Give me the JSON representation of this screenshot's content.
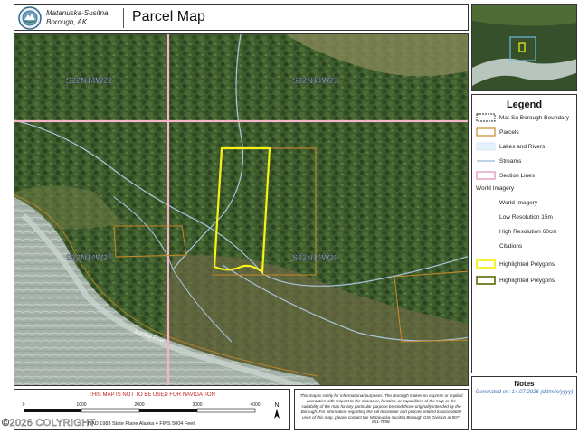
{
  "header": {
    "org_line1": "Matanuska-Susitna",
    "org_line2": "Borough, AK",
    "title": "Parcel Map"
  },
  "map": {
    "section_labels": [
      "S22N14W22",
      "S22N14W23",
      "S22N14W27",
      "S22N14W26"
    ],
    "river_label": "Susitna River"
  },
  "colors": {
    "section_lines": "#f4b6c6",
    "parcels": "#c98a2a",
    "highlight": "#f5f21a",
    "streams": "#a9c6dd",
    "forest": "#3d5a2c",
    "riverbed": "#a8b6ad"
  },
  "legend": {
    "title": "Legend",
    "items": [
      {
        "label": "Mat-Su Borough Boundary",
        "indent": false
      },
      {
        "label": "Parcels",
        "indent": false
      },
      {
        "label": "Lakes and Rivers",
        "indent": false
      },
      {
        "label": "Streams",
        "indent": false
      },
      {
        "label": "Section Lines",
        "indent": false
      },
      {
        "label": "World Imagery",
        "indent": false
      },
      {
        "label": "World Imagery",
        "indent": true
      },
      {
        "label": "Low Resolution 15m",
        "indent": true
      },
      {
        "label": "High Resolution 60cm",
        "indent": true
      },
      {
        "label": "Citations",
        "indent": true
      },
      {
        "label": "Highlighted Polygons",
        "indent": false
      },
      {
        "label": "Highlighted Polygons",
        "indent": false
      }
    ]
  },
  "notes": {
    "title": "Notes",
    "text": "Generated on: 14.07.2026 (dd/mm/yyyy)"
  },
  "scale": {
    "warning": "THIS MAP IS NOT TO BE USED FOR NAVIGATION",
    "ticks": [
      "0",
      "1000",
      "2000",
      "3000",
      "4000"
    ],
    "north_label": "N",
    "projection": "NAD 1983 State Plane Alaska 4 FIPS 5004 Feet"
  },
  "disclaimer": "This map is solely for informational purposes. The Borough makes no express or implied warranties with respect to the character, function, or capabilities of the map or the suitability of the map for any particular purpose beyond those originally intended by the Borough. For information regarding the full disclaimer and policies related to acceptable uses of this map, please contact the Matanuska-Susitna Borough GIS Division at 907-861-7858.",
  "copyright": "©2026 COLYRIGHT"
}
